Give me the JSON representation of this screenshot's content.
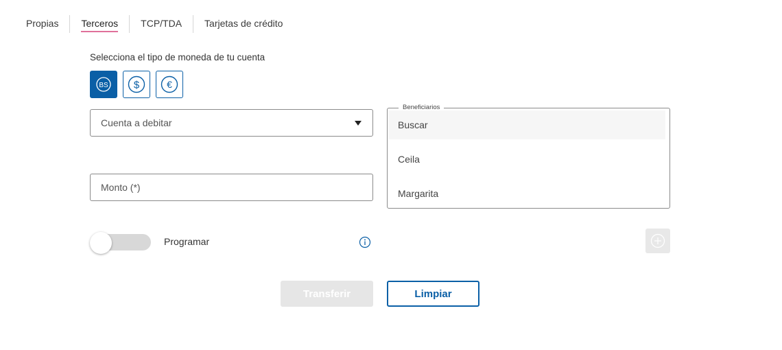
{
  "tabs": [
    {
      "label": "Propias"
    },
    {
      "label": "Terceros"
    },
    {
      "label": "TCP/TDA"
    },
    {
      "label": "Tarjetas de crédito"
    }
  ],
  "currency": {
    "label": "Selecciona el tipo de moneda de tu cuenta",
    "options": [
      {
        "symbol": "BS",
        "icon": "bolivar-icon",
        "selected": true
      },
      {
        "symbol": "$",
        "icon": "dollar-icon",
        "selected": false
      },
      {
        "symbol": "€",
        "icon": "euro-icon",
        "selected": false
      }
    ]
  },
  "form": {
    "cuenta_label": "Cuenta a debitar",
    "monto_label": "Monto (*)",
    "programar_label": "Programar",
    "programar_on": false
  },
  "beneficiarios": {
    "legend": "Beneficiarios",
    "search_placeholder": "Buscar",
    "items": [
      "Ceila",
      "Margarita"
    ]
  },
  "actions": {
    "transfer_label": "Transferir",
    "clear_label": "Limpiar"
  },
  "colors": {
    "primary": "#0a5fa6",
    "active_tab_underline": "#e0709a",
    "disabled": "#e6e6e6"
  }
}
